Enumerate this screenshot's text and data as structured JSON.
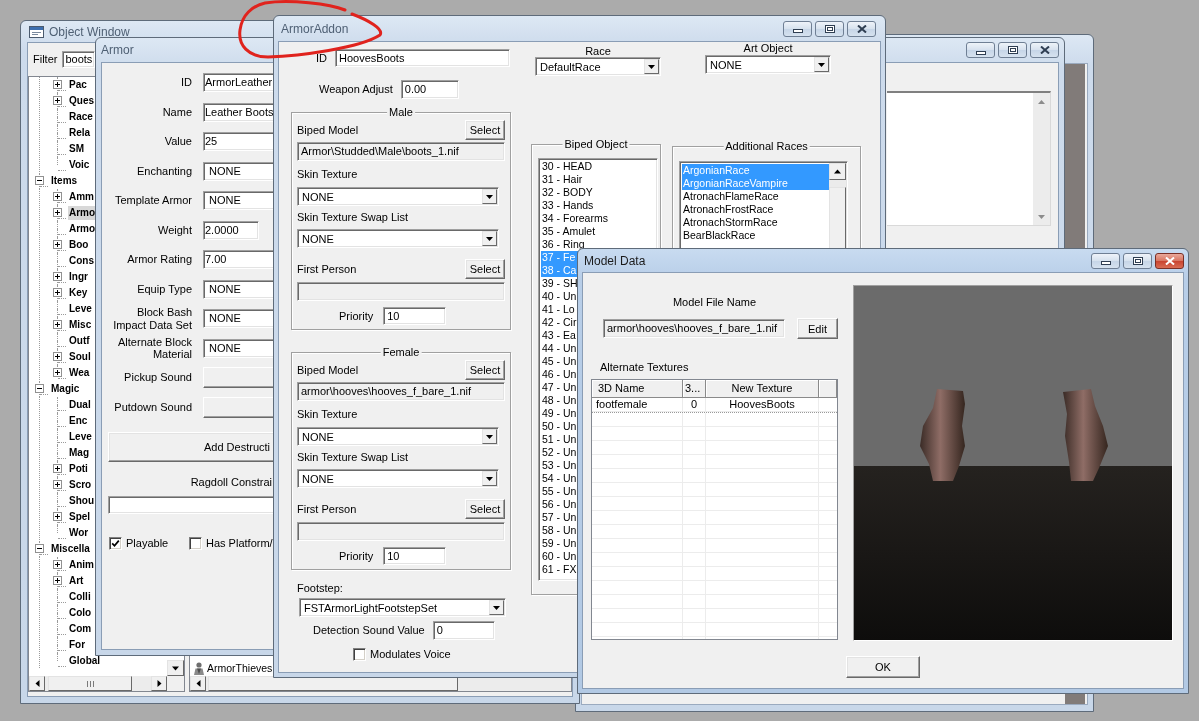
{
  "object_window": {
    "title": "Object Window",
    "active": false,
    "filter": {
      "label": "Filter",
      "value": "boots"
    },
    "tree": {
      "continued_children": [
        {
          "label": "Pac",
          "expandable": true,
          "expanded": false,
          "selected": false
        },
        {
          "label": "Ques",
          "expandable": true,
          "expanded": false,
          "selected": false
        },
        {
          "label": "Race",
          "expandable": false,
          "selected": false
        },
        {
          "label": "Rela",
          "expandable": false,
          "selected": false
        },
        {
          "label": "SM",
          "expandable": false,
          "selected": false
        },
        {
          "label": "Voic",
          "expandable": false,
          "selected": false
        }
      ],
      "nodes": [
        {
          "label": "Items",
          "expandable": true,
          "expanded": true,
          "selected": false,
          "children": [
            {
              "label": "Amm",
              "expandable": true,
              "expanded": false,
              "selected": false
            },
            {
              "label": "Armo",
              "expandable": true,
              "expanded": false,
              "selected": true
            },
            {
              "label": "Armo",
              "expandable": false,
              "selected": false
            },
            {
              "label": "Boo",
              "expandable": true,
              "expanded": false,
              "selected": false
            },
            {
              "label": "Cons",
              "expandable": false,
              "selected": false
            },
            {
              "label": "Ingr",
              "expandable": true,
              "expanded": false,
              "selected": false
            },
            {
              "label": "Key",
              "expandable": true,
              "expanded": false,
              "selected": false
            },
            {
              "label": "Leve",
              "expandable": false,
              "selected": false
            },
            {
              "label": "Misc",
              "expandable": true,
              "expanded": false,
              "selected": false
            },
            {
              "label": "Outf",
              "expandable": false,
              "selected": false
            },
            {
              "label": "Soul",
              "expandable": true,
              "expanded": false,
              "selected": false
            },
            {
              "label": "Wea",
              "expandable": true,
              "expanded": false,
              "selected": false
            }
          ]
        },
        {
          "label": "Magic",
          "expandable": true,
          "expanded": true,
          "selected": false,
          "children": [
            {
              "label": "Dual",
              "expandable": false,
              "selected": false
            },
            {
              "label": "Enc",
              "expandable": false,
              "selected": false
            },
            {
              "label": "Leve",
              "expandable": false,
              "selected": false
            },
            {
              "label": "Mag",
              "expandable": false,
              "selected": false
            },
            {
              "label": "Poti",
              "expandable": true,
              "expanded": false,
              "selected": false
            },
            {
              "label": "Scro",
              "expandable": true,
              "expanded": false,
              "selected": false
            },
            {
              "label": "Shou",
              "expandable": false,
              "selected": false
            },
            {
              "label": "Spel",
              "expandable": true,
              "expanded": false,
              "selected": false
            },
            {
              "label": "Wor",
              "expandable": false,
              "selected": false
            }
          ]
        },
        {
          "label": "Miscella",
          "expandable": true,
          "expanded": true,
          "selected": false,
          "children": [
            {
              "label": "Anim",
              "expandable": true,
              "expanded": false,
              "selected": false
            },
            {
              "label": "Art",
              "expandable": true,
              "expanded": false,
              "selected": false
            },
            {
              "label": "Colli",
              "expandable": false,
              "selected": false
            },
            {
              "label": "Colo",
              "expandable": false,
              "selected": false
            },
            {
              "label": "Com",
              "expandable": false,
              "selected": false
            },
            {
              "label": "For",
              "expandable": false,
              "selected": false
            },
            {
              "label": "Global",
              "expandable": false,
              "selected": false
            }
          ]
        }
      ]
    },
    "records": [
      {
        "label": "ArmorThieves"
      }
    ]
  },
  "armor_window": {
    "title": "Armor",
    "active": false,
    "fields": [
      {
        "label": "ID",
        "kind": "text",
        "value": "ArmorLeather"
      },
      {
        "label": "Name",
        "kind": "text",
        "value": "Leather Boots"
      },
      {
        "label": "Value",
        "kind": "text",
        "value": "25"
      },
      {
        "label": "Enchanting",
        "kind": "dropdown",
        "value": "NONE"
      },
      {
        "label": "Template Armor",
        "kind": "dropdown",
        "value": "NONE"
      },
      {
        "label": "Weight",
        "kind": "short",
        "value": "2.0000"
      },
      {
        "label": "Armor Rating",
        "kind": "text",
        "value": "7.00"
      },
      {
        "label": "Equip Type",
        "kind": "dropdown",
        "value": "NONE"
      },
      {
        "label": "Block Bash Impact Data Set",
        "kind": "dropdown",
        "value": "NONE"
      },
      {
        "label": "Alternate Block Material",
        "kind": "dropdown",
        "value": "NONE"
      },
      {
        "label": "Pickup Sound",
        "kind": "combo"
      },
      {
        "label": "Putdown Sound",
        "kind": "combo"
      }
    ],
    "destruction_button": "Add Destructi",
    "ragdoll_label": "Ragdoll Constrai",
    "checkboxes": [
      {
        "label": "Playable",
        "checked": true
      },
      {
        "label": "Has Platform/",
        "checked": false
      }
    ]
  },
  "armor_addon_window": {
    "title": "ArmorAddon",
    "active": false,
    "id": {
      "label": "ID",
      "value": "HoovesBoots"
    },
    "weapon_adjust": {
      "label": "Weapon Adjust",
      "value": "0.00"
    },
    "race": {
      "label": "Race",
      "value": "DefaultRace"
    },
    "art_object": {
      "label": "Art Object",
      "value": "NONE"
    },
    "model_groups": [
      {
        "title": "Male",
        "biped_model": {
          "label": "Biped Model",
          "button": "Select",
          "path": "Armor\\Studded\\Male\\boots_1.nif"
        },
        "skin_texture": {
          "label": "Skin Texture",
          "value": "NONE"
        },
        "swap_list": {
          "label": "Skin Texture Swap List",
          "value": "NONE"
        },
        "first_person": {
          "label": "First Person",
          "button": "Select"
        },
        "priority": {
          "label": "Priority",
          "value": "10"
        }
      },
      {
        "title": "Female",
        "biped_model": {
          "label": "Biped Model",
          "button": "Select",
          "path": "armor\\hooves\\hooves_f_bare_1.nif"
        },
        "skin_texture": {
          "label": "Skin Texture",
          "value": "NONE"
        },
        "swap_list": {
          "label": "Skin Texture Swap List",
          "value": "NONE"
        },
        "first_person": {
          "label": "First Person",
          "button": "Select"
        },
        "priority": {
          "label": "Priority",
          "value": "10"
        }
      }
    ],
    "footstep": {
      "label": "Footstep:",
      "value": "FSTArmorLightFootstepSet"
    },
    "detection_sound": {
      "label": "Detection Sound Value",
      "value": "0"
    },
    "modulates_voice": {
      "label": "Modulates Voice",
      "checked": false
    },
    "biped_object": {
      "title": "Biped Object",
      "items": [
        {
          "label": "30 - HEAD",
          "selected": false
        },
        {
          "label": "31 - Hair",
          "selected": false
        },
        {
          "label": "32 - BODY",
          "selected": false
        },
        {
          "label": "33 - Hands",
          "selected": false
        },
        {
          "label": "34 - Forearms",
          "selected": false
        },
        {
          "label": "35 - Amulet",
          "selected": false
        },
        {
          "label": "36 - Ring",
          "selected": false
        },
        {
          "label": "37 - Fe",
          "selected": true
        },
        {
          "label": "38 - Ca",
          "selected": true
        },
        {
          "label": "39 - SH",
          "selected": false
        },
        {
          "label": "40 - Un",
          "selected": false
        },
        {
          "label": "41 - Lo",
          "selected": false
        },
        {
          "label": "42 - Cir",
          "selected": false
        },
        {
          "label": "43 - Ea",
          "selected": false
        },
        {
          "label": "44 - Un",
          "selected": false
        },
        {
          "label": "45 - Un",
          "selected": false
        },
        {
          "label": "46 - Un",
          "selected": false
        },
        {
          "label": "47 - Un",
          "selected": false
        },
        {
          "label": "48 - Un",
          "selected": false
        },
        {
          "label": "49 - Un",
          "selected": false
        },
        {
          "label": "50 - Un",
          "selected": false
        },
        {
          "label": "51 - Un",
          "selected": false
        },
        {
          "label": "52 - Un",
          "selected": false
        },
        {
          "label": "53 - Un",
          "selected": false
        },
        {
          "label": "54 - Un",
          "selected": false
        },
        {
          "label": "55 - Un",
          "selected": false
        },
        {
          "label": "56 - Un",
          "selected": false
        },
        {
          "label": "57 - Un",
          "selected": false
        },
        {
          "label": "58 - Un",
          "selected": false
        },
        {
          "label": "59 - Un",
          "selected": false
        },
        {
          "label": "60 - Un",
          "selected": false
        },
        {
          "label": "61 - FX",
          "selected": false
        }
      ]
    },
    "additional_races": {
      "title": "Additional Races",
      "items": [
        {
          "label": "ArgonianRace",
          "selected": true
        },
        {
          "label": "ArgonianRaceVampire",
          "selected": true
        },
        {
          "label": "AtronachFlameRace",
          "selected": false
        },
        {
          "label": "AtronachFrostRace",
          "selected": false
        },
        {
          "label": "AtronachStormRace",
          "selected": false
        },
        {
          "label": "BearBlackRace",
          "selected": false
        }
      ]
    }
  },
  "model_data_window": {
    "title": "Model Data",
    "active": true,
    "model_file": {
      "label": "Model File Name",
      "value": "armor\\hooves\\hooves_f_bare_1.nif",
      "button": "Edit"
    },
    "alternate_textures": {
      "label": "Alternate Textures"
    },
    "table": {
      "columns": [
        "3D Name",
        "3...",
        "New Texture"
      ],
      "rows": [
        [
          "footfemale",
          "0",
          "HoovesBoots"
        ]
      ]
    },
    "ok_button": "OK"
  }
}
